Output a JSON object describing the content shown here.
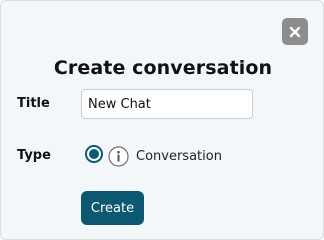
{
  "dialog": {
    "title": "Create conversation",
    "close_icon": "close-icon"
  },
  "form": {
    "title_label": "Title",
    "title_value": "New Chat",
    "type_label": "Type",
    "type_option": {
      "label": "Conversation",
      "selected": true,
      "info_icon": "info-icon"
    }
  },
  "actions": {
    "create_label": "Create"
  },
  "colors": {
    "accent": "#0b5870",
    "close_button": "#8d8d8d",
    "background": "#f4f7fa"
  }
}
